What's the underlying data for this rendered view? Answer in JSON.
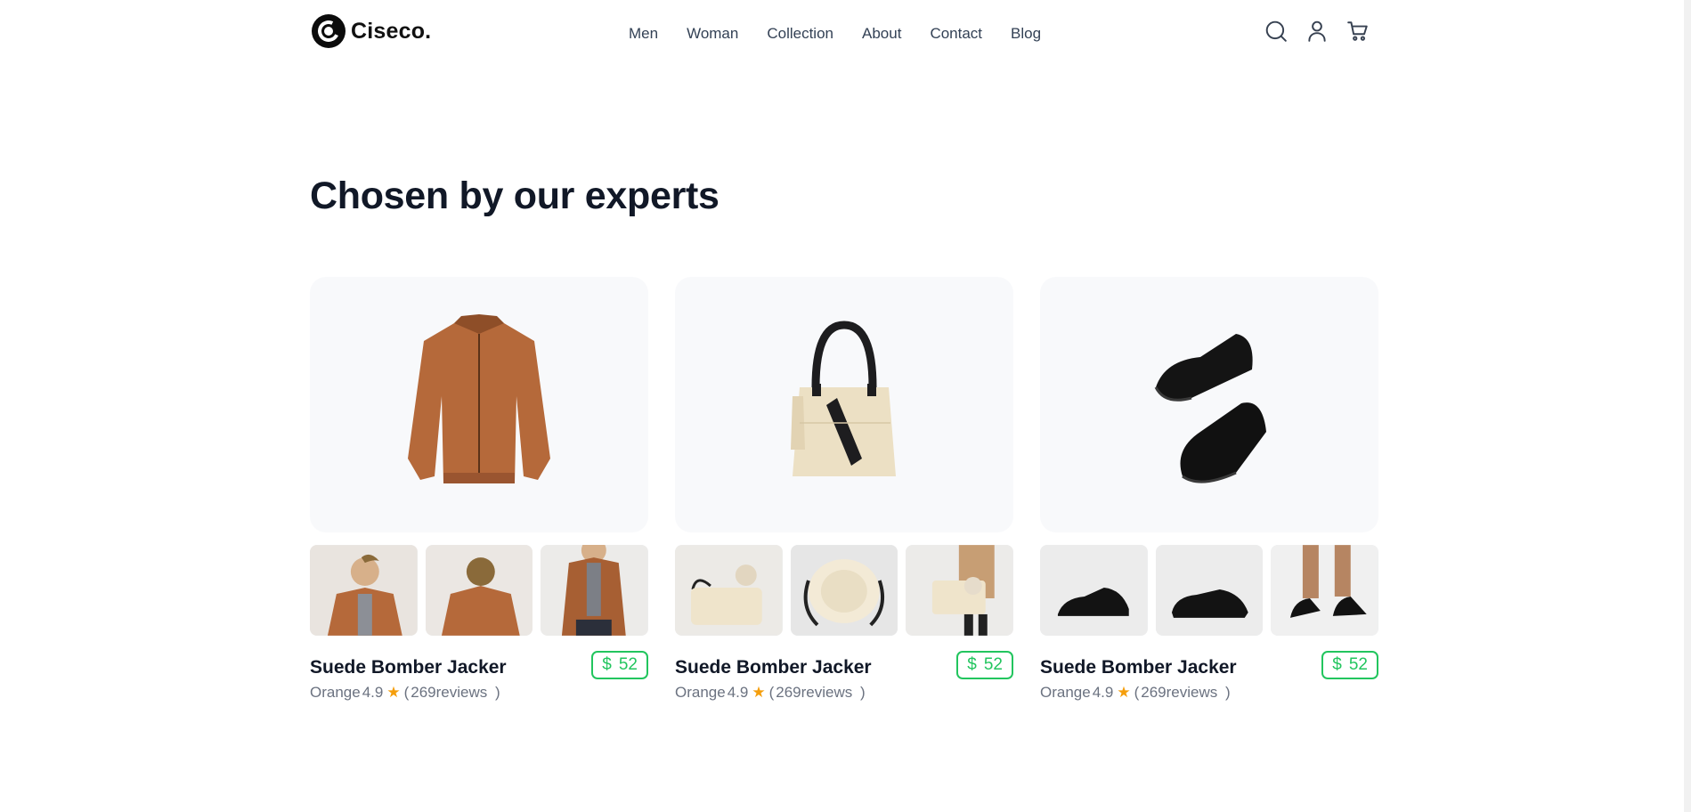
{
  "header": {
    "logo_text": "Ciseco.",
    "nav": [
      "Men",
      "Woman",
      "Collection",
      "About",
      "Contact",
      "Blog"
    ],
    "icons": [
      "search-icon",
      "user-icon",
      "cart-icon"
    ]
  },
  "section": {
    "title": "Chosen by our experts"
  },
  "products": [
    {
      "name": "Suede Bomber Jacker",
      "color": "Orange",
      "rating": "4.9",
      "reviews_open": "(",
      "reviews": "269reviews",
      "reviews_close": ")",
      "currency": "$",
      "price": "52",
      "image": "suede-jacket"
    },
    {
      "name": "Suede Bomber Jacker",
      "color": "Orange",
      "rating": "4.9",
      "reviews_open": "(",
      "reviews": "269reviews",
      "reviews_close": ")",
      "currency": "$",
      "price": "52",
      "image": "tote-bag"
    },
    {
      "name": "Suede Bomber Jacker",
      "color": "Orange",
      "rating": "4.9",
      "reviews_open": "(",
      "reviews": "269reviews",
      "reviews_close": ")",
      "currency": "$",
      "price": "52",
      "image": "black-sneakers"
    }
  ],
  "colors": {
    "accent_green": "#22c55e",
    "star": "#f59e0b",
    "card_bg": "#f8f9fb",
    "jacket": "#b5693a",
    "bag": "#ece0c4"
  }
}
